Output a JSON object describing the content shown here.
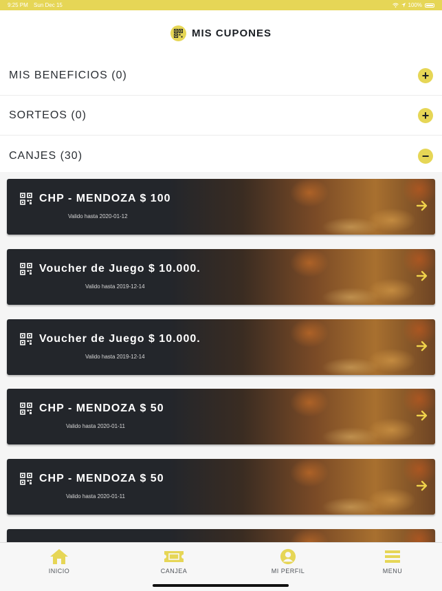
{
  "status_bar": {
    "time": "9:25 PM",
    "date": "Sun Dec 15",
    "battery": "100%"
  },
  "header": {
    "title": "MIS CUPONES",
    "icon": "qr-code-icon"
  },
  "sections": [
    {
      "label": "MIS BENEFICIOS (0)",
      "toggle": "+"
    },
    {
      "label": "SORTEOS (0)",
      "toggle": "+"
    },
    {
      "label": "CANJES (30)",
      "toggle": "−"
    }
  ],
  "coupons": [
    {
      "title": "CHP - MENDOZA $ 100",
      "valid": "Valido hasta 2020-01-12"
    },
    {
      "title": "Voucher de Juego $ 10.000.",
      "valid": "Valido hasta 2019-12-14"
    },
    {
      "title": "Voucher de Juego $ 10.000.",
      "valid": "Valido hasta 2019-12-14"
    },
    {
      "title": "CHP - MENDOZA $ 50",
      "valid": "Valido hasta 2020-01-11"
    },
    {
      "title": "CHP - MENDOZA $ 50",
      "valid": "Valido hasta 2020-01-11"
    }
  ],
  "tabs": [
    {
      "label": "INICIO",
      "icon": "home-icon"
    },
    {
      "label": "CANJEA",
      "icon": "ticket-icon"
    },
    {
      "label": "MI PERFIL",
      "icon": "user-icon"
    },
    {
      "label": "MENU",
      "icon": "menu-icon"
    }
  ],
  "colors": {
    "accent": "#e6d656",
    "dark": "#1b1f24",
    "card": "#23262b"
  }
}
